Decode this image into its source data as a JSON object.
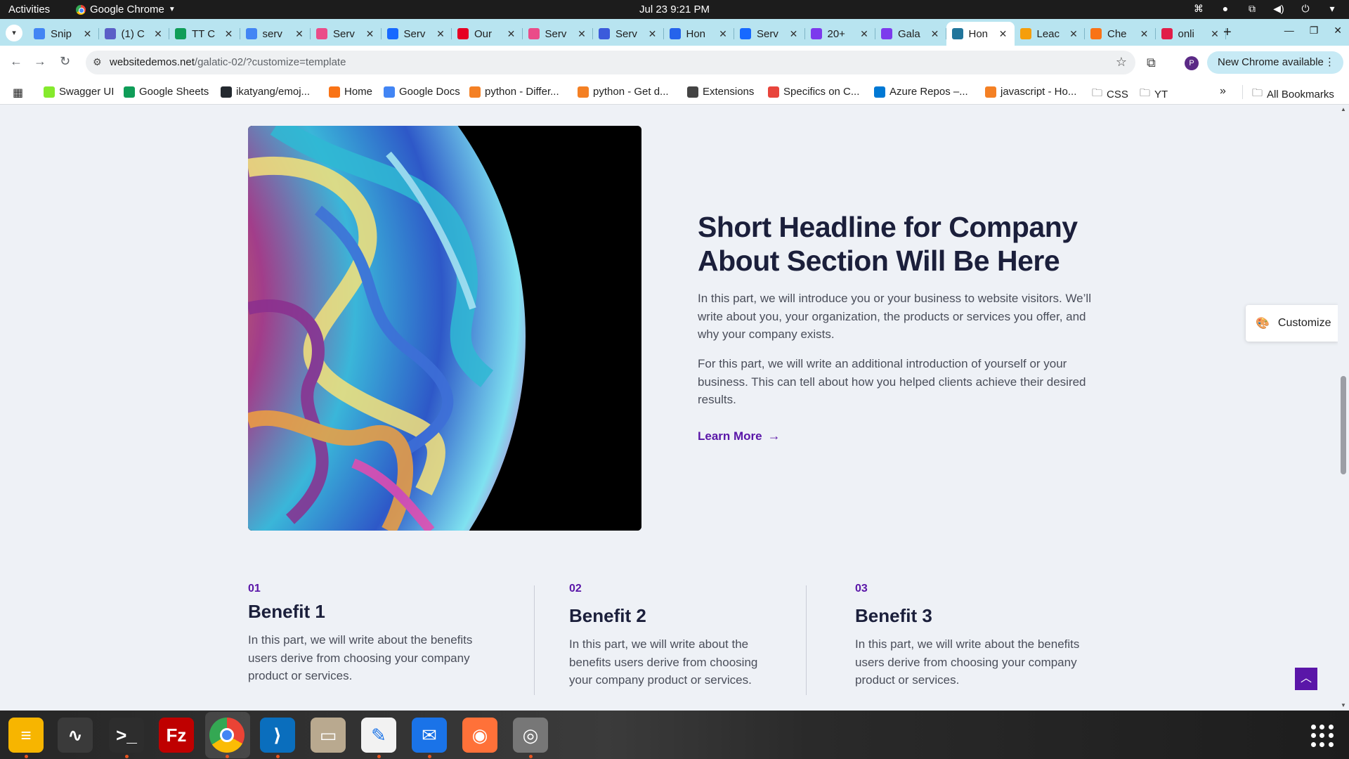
{
  "topbar": {
    "activities": "Activities",
    "app_name": "Google Chrome",
    "clock": "Jul 23  9:21 PM"
  },
  "tabs": [
    {
      "title": "Snip",
      "color": "#4285f4"
    },
    {
      "title": "(1) C",
      "color": "#5b5fc7"
    },
    {
      "title": "TT C",
      "color": "#0f9d58"
    },
    {
      "title": "serv",
      "color": "#4285f4"
    },
    {
      "title": "Serv",
      "color": "#ea4c89"
    },
    {
      "title": "Serv",
      "color": "#1769ff"
    },
    {
      "title": "Our",
      "color": "#e60023"
    },
    {
      "title": "Serv",
      "color": "#ea4c89"
    },
    {
      "title": "Serv",
      "color": "#3b5bdb"
    },
    {
      "title": "Hon",
      "color": "#2563eb"
    },
    {
      "title": "Serv",
      "color": "#1769ff"
    },
    {
      "title": "20+",
      "color": "#7c3aed"
    },
    {
      "title": "Gala",
      "color": "#7c3aed"
    },
    {
      "title": "Hon",
      "color": "#21759b"
    },
    {
      "title": "Leac",
      "color": "#f59e0b"
    },
    {
      "title": "Che",
      "color": "#f97316"
    },
    {
      "title": "onli",
      "color": "#e11d48"
    }
  ],
  "active_tab_index": 13,
  "omnibox": {
    "host": "websitedemos.net",
    "path": "/galatic-02/?customize=template"
  },
  "update_button": "New Chrome available",
  "profile_initial": "P",
  "bookmarks": [
    {
      "label": "Swagger UI",
      "color": "#85ea2d"
    },
    {
      "label": "Google Sheets",
      "color": "#0f9d58"
    },
    {
      "label": "ikatyang/emoj...",
      "color": "#24292f"
    },
    {
      "label": "Home",
      "color": "#f97316"
    },
    {
      "label": "Google Docs",
      "color": "#4285f4"
    },
    {
      "label": "python - Differ...",
      "color": "#f48024"
    },
    {
      "label": "python - Get d...",
      "color": "#f48024"
    },
    {
      "label": "Extensions",
      "color": "#444444"
    },
    {
      "label": "Specifics on C...",
      "color": "#e8453c"
    },
    {
      "label": "Azure Repos –...",
      "color": "#0078d4"
    },
    {
      "label": "javascript - Ho...",
      "color": "#f48024"
    },
    {
      "label": "CSS",
      "color": "folder"
    },
    {
      "label": "YT",
      "color": "folder"
    }
  ],
  "all_bookmarks": "All Bookmarks",
  "about": {
    "headline": "Short Headline for Company About Section Will Be Here",
    "para1": "In this part, we will introduce you or your business to website visitors. We’ll write about you, your organization, the products or services you offer, and why your company exists.",
    "para2": "For this part, we will write an additional introduction of yourself or your business. This can tell about how you helped clients achieve their desired results.",
    "learn_more": "Learn More"
  },
  "benefits": [
    {
      "num": "01",
      "title": "Benefit 1",
      "text": "In this part, we will write about the benefits users derive from choosing your company product or services."
    },
    {
      "num": "02",
      "title": "Benefit 2",
      "text": "In this part, we will write about the benefits users derive from choosing your company product or services."
    },
    {
      "num": "03",
      "title": "Benefit 3",
      "text": "In this part, we will write about the benefits users derive from choosing your company product or services."
    }
  ],
  "customize_button": "Customize",
  "colors": {
    "accent": "#5a16a8",
    "heading": "#1b1f3b",
    "page_bg": "#eef1f6",
    "tab_strip": "#b8e4f0"
  },
  "dock": [
    {
      "name": "notes-app-icon",
      "color": "#f7b500",
      "glyph": "≡"
    },
    {
      "name": "system-monitor-icon",
      "color": "#3a3a3a",
      "glyph": "∿"
    },
    {
      "name": "terminal-icon",
      "color": "#2d2d2d",
      "glyph": ">_"
    },
    {
      "name": "filezilla-icon",
      "color": "#bf0000",
      "glyph": "Fz"
    },
    {
      "name": "chrome-icon",
      "color": "chrome",
      "glyph": ""
    },
    {
      "name": "vscode-icon",
      "color": "#0a6ebd",
      "glyph": "⟩"
    },
    {
      "name": "files-icon",
      "color": "#b9a98f",
      "glyph": "▭"
    },
    {
      "name": "text-editor-icon",
      "color": "#f2f2f2",
      "glyph": "✎"
    },
    {
      "name": "thunderbird-icon",
      "color": "#1a73e8",
      "glyph": "✉"
    },
    {
      "name": "firefox-icon",
      "color": "#ff7139",
      "glyph": "◉"
    },
    {
      "name": "disks-icon",
      "color": "#777777",
      "glyph": "◎"
    }
  ]
}
